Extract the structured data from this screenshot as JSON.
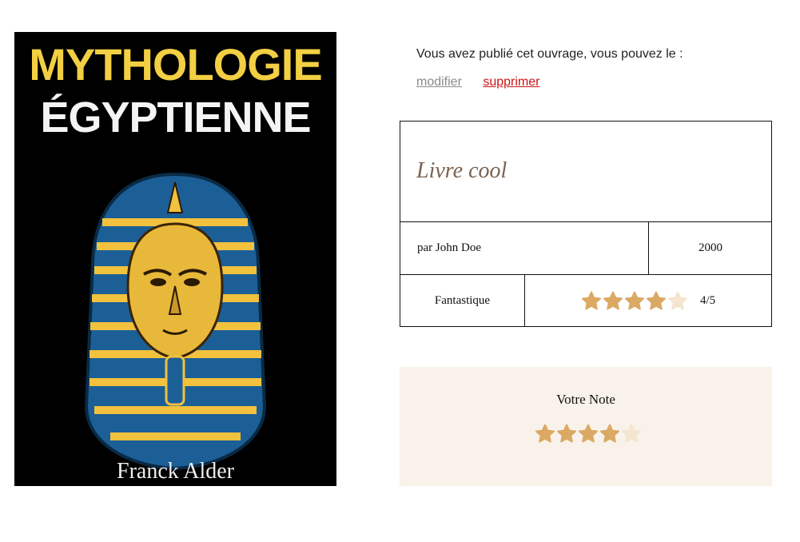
{
  "cover": {
    "title_line1": "MYTHOLOGIE",
    "title_line2": "ÉGYPTIENNE",
    "author": "Franck Alder"
  },
  "actions": {
    "intro": "Vous avez publié cet ouvrage, vous pouvez le :",
    "edit_label": "modifier",
    "delete_label": "supprimer"
  },
  "book": {
    "title": "Livre cool",
    "author": "par John Doe",
    "year": "2000",
    "genre": "Fantastique",
    "rating_text": "4/5",
    "rating": 4,
    "rating_max": 5
  },
  "vote": {
    "label": "Votre Note",
    "rating": 4,
    "rating_max": 5
  },
  "colors": {
    "star_filled": "#dba964",
    "star_empty": "#f3e5d0",
    "delete_link": "#c81414",
    "vote_bg": "#f8f2ea"
  }
}
